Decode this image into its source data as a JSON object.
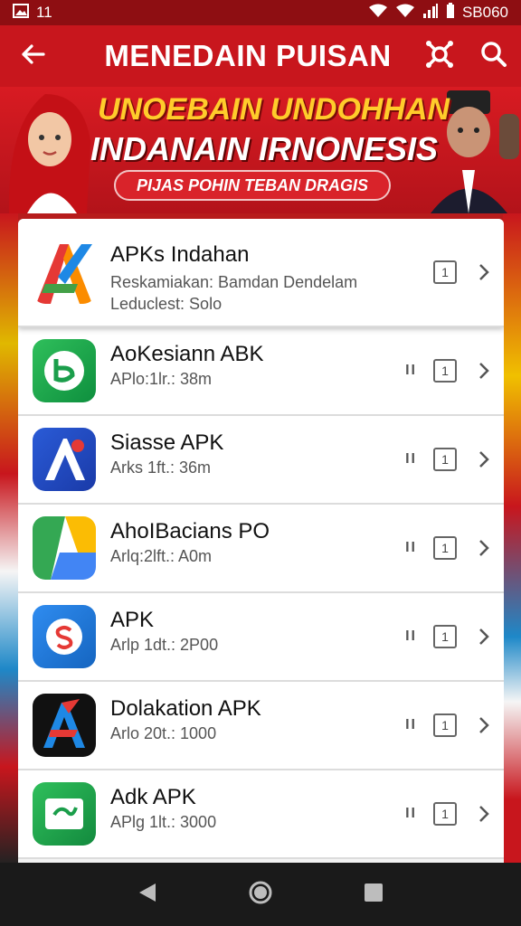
{
  "status_bar": {
    "time": "11",
    "right_text": "SB060"
  },
  "app_bar": {
    "title": "MENEDAIN PUISAN"
  },
  "banner": {
    "line1": "UNOEBAIN UNDOHHAN",
    "line2": "INDANAIN IRNONESIS",
    "pill": "PIJAS POHIN TEBAN DRAGIS"
  },
  "apps": [
    {
      "name": "APKs Indahan",
      "sub": "Reskamiakan: Bamdan Dendelam",
      "meta": "Leduclest: Solo",
      "count": "1",
      "pause": "",
      "icon": "app-icon-a-tricolor"
    },
    {
      "name": "AoKesiann ABK",
      "sub": "",
      "meta": "APlo:1lr.: 38m",
      "count": "1",
      "pause": "II",
      "icon": "app-icon-green-b"
    },
    {
      "name": "Siasse APK",
      "sub": "",
      "meta": "Arks 1ft.: 36m",
      "count": "1",
      "pause": "II",
      "icon": "app-icon-blue-a"
    },
    {
      "name": "AhoIBacians PO",
      "sub": "",
      "meta": "Arlq:2lft.: A0m",
      "count": "1",
      "pause": "II",
      "icon": "app-icon-drive"
    },
    {
      "name": "APK",
      "sub": "",
      "meta": "Arlp 1dt.: 2P00",
      "count": "1",
      "pause": "II",
      "icon": "app-icon-blue-s"
    },
    {
      "name": "Dolakation APK",
      "sub": "",
      "meta": "Arlo 20t.: 1000",
      "count": "1",
      "pause": "II",
      "icon": "app-icon-dark-a"
    },
    {
      "name": "Adk APK",
      "sub": "",
      "meta": "APlg 1lt.: 3000",
      "count": "1",
      "pause": "II",
      "icon": "app-icon-green-card"
    }
  ],
  "colors": {
    "primary": "#c8161d",
    "banner_gold": "#ffcc2b",
    "nav": "#1a1a1a"
  }
}
